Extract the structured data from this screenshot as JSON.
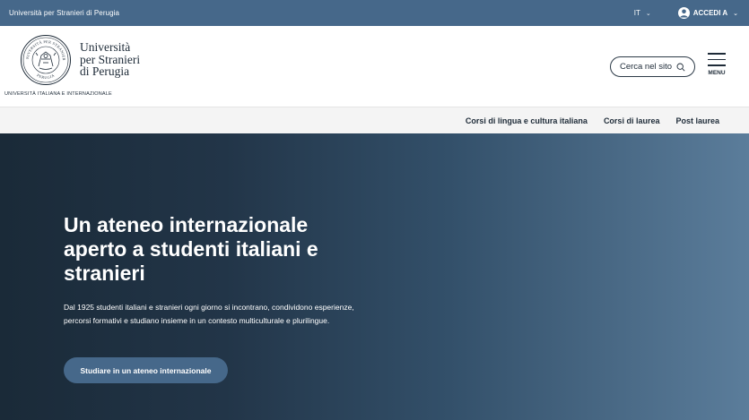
{
  "topbar": {
    "university": "Università per Stranieri di Perugia",
    "lang": "IT",
    "login": "ACCEDI A"
  },
  "header": {
    "logo_line1": "Università",
    "logo_line2": "per Stranieri",
    "logo_line3": "di Perugia",
    "logo_sub": "UNIVERSITÀ ITALIANA E INTERNAZIONALE",
    "seal_top": "UNIVERSITÀ PER STRANIERI",
    "seal_bottom": "PERUGIA",
    "search_label": "Cerca nel sito",
    "menu_label": "MENU"
  },
  "nav": {
    "items": [
      {
        "label": "Corsi di lingua e cultura italiana"
      },
      {
        "label": "Corsi di laurea"
      },
      {
        "label": "Post laurea"
      }
    ]
  },
  "hero": {
    "title": "Un ateneo internazionale aperto a studenti italiani e stranieri",
    "text": "Dal 1925 studenti italiani e stranieri ogni giorno si incontrano, condividono esperienze, percorsi formativi e studiano insieme in un contesto multiculturale e plurilingue.",
    "cta": "Studiare in un ateneo internazionale"
  },
  "colors": {
    "accent": "#46688a",
    "text_dark": "#1e2b38",
    "nav_bg": "#f4f4f4"
  }
}
